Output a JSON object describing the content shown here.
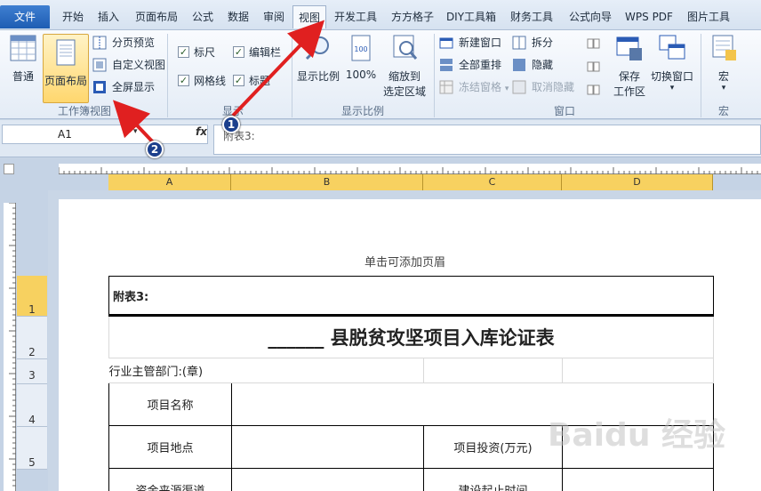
{
  "tabs": [
    "文件",
    "开始",
    "插入",
    "页面布局",
    "公式",
    "数据",
    "审阅",
    "视图",
    "开发工具",
    "方方格子",
    "DIY工具箱",
    "财务工具",
    "公式向导",
    "WPS PDF",
    "图片工具"
  ],
  "ribbon": {
    "workbook_views": {
      "label": "工作簿视图",
      "normal": "普通",
      "page_layout": "页面布局",
      "page_break": "分页预览",
      "custom_view": "自定义视图",
      "full_screen": "全屏显示"
    },
    "show": {
      "label": "显示",
      "ruler": "标尺",
      "formula_bar": "编辑栏",
      "gridlines": "网格线",
      "headings": "标题",
      "ruler_checked": true,
      "formula_bar_checked": true,
      "gridlines_checked": true,
      "headings_checked": true
    },
    "zoom": {
      "label": "显示比例",
      "zoom": "显示比例",
      "hundred": "100%",
      "zoom_selection_line1": "缩放到",
      "zoom_selection_line2": "选定区域"
    },
    "window": {
      "label": "窗口",
      "new_window": "新建窗口",
      "arrange_all": "全部重排",
      "freeze_panes": "冻结窗格",
      "split": "拆分",
      "hide": "隐藏",
      "unhide": "取消隐藏",
      "save_workspace_line1": "保存",
      "save_workspace_line2": "工作区",
      "switch_windows": "切换窗口"
    },
    "macros": {
      "label": "宏",
      "macros": "宏"
    }
  },
  "formula_bar": {
    "name_box": "A1",
    "fx": "fx",
    "value": "附表3:"
  },
  "columns": [
    "A",
    "B",
    "C",
    "D"
  ],
  "rows": [
    "1",
    "2",
    "3",
    "4",
    "5"
  ],
  "page": {
    "header_hint": "单击可添加页眉",
    "a1": "附表3:",
    "title": "______ 县脱贫攻坚项目入库论证表",
    "dept": "行业主管部门:(章)",
    "project_name": "项目名称",
    "project_location": "项目地点",
    "investment": "项目投资(万元)",
    "fund_source": "资金来源渠道",
    "time": "建设起止时间"
  },
  "annotations": {
    "badge1": "1",
    "badge2": "2"
  },
  "watermark": "Baidu 经验",
  "colors": {
    "selected_header": "#f7d160",
    "annotation_arrow": "#e02020",
    "file_tab": "#2a6bc4"
  }
}
